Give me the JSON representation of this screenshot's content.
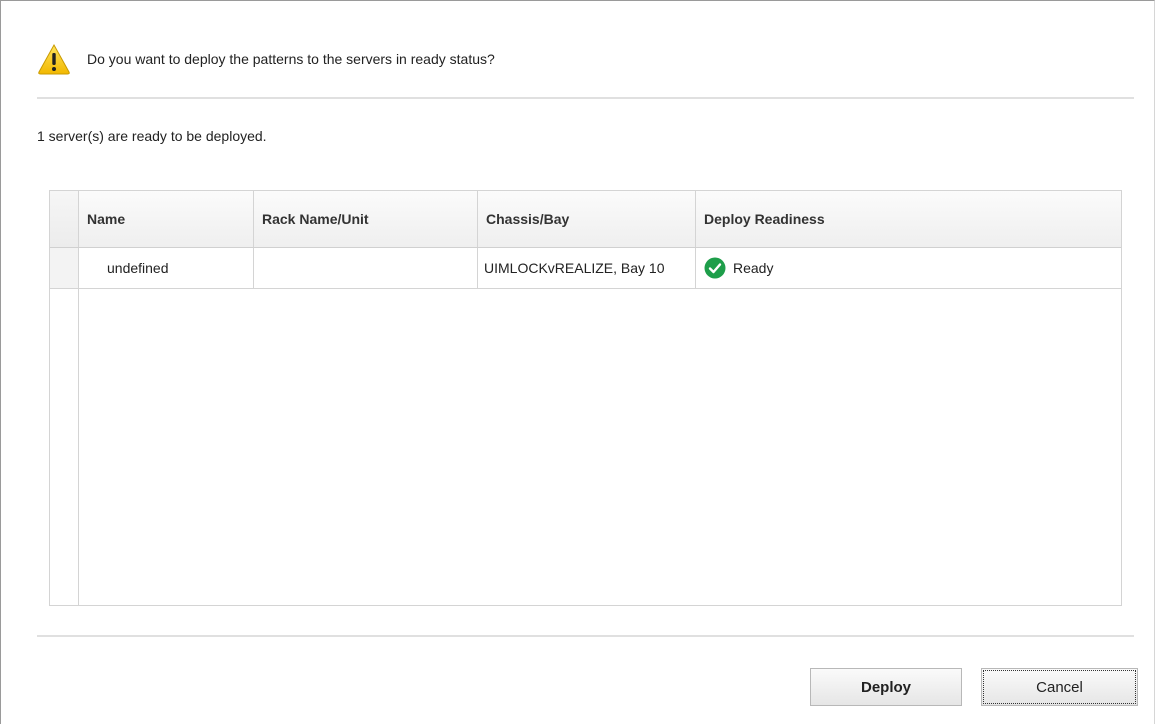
{
  "dialog": {
    "question": "Do you want to deploy the patterns to the servers in ready status?",
    "ready_message": "1 server(s) are ready to be deployed.",
    "warning_icon": "warning-triangle-icon",
    "accent_warning": "#f5c400"
  },
  "table": {
    "columns": {
      "name": "Name",
      "rack": "Rack Name/Unit",
      "chassis": "Chassis/Bay",
      "readiness": "Deploy Readiness"
    },
    "rows": [
      {
        "name": "undefined",
        "rack": "",
        "chassis": "UIMLOCKvREALIZE, Bay 10",
        "readiness": "Ready",
        "status_icon": "check-circle-icon",
        "status_color": "#1e9e4a"
      }
    ]
  },
  "buttons": {
    "deploy": "Deploy",
    "cancel": "Cancel"
  }
}
